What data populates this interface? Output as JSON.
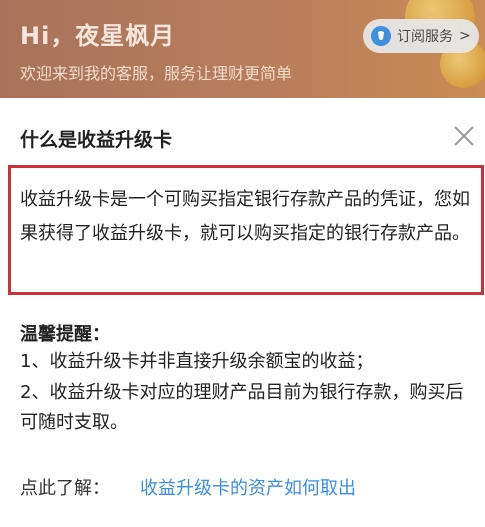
{
  "header": {
    "greeting": "Hi，夜星枫月",
    "welcome": "欢迎来到我的客服，服务让理财更简单",
    "subscribe_label": "订阅服务",
    "subscribe_arrow": ">"
  },
  "modal": {
    "title": "什么是收益升级卡",
    "definition": "收益升级卡是一个可购买指定银行存款产品的凭证，您如果获得了收益升级卡，就可以购买指定的银行存款产品。",
    "tips_title": "温馨提醒：",
    "tips": [
      "1、收益升级卡并非直接升级余额宝的收益；",
      "2、收益升级卡对应的理财产品目前为银行存款，购买后可随时支取。"
    ],
    "learn_label": "点此了解：",
    "learn_link": "收益升级卡的资产如何取出"
  },
  "colors": {
    "header_bg": "#b87d5c",
    "highlight_border": "#c9313b",
    "link": "#3a8ee6",
    "subscribe_icon": "#3f8ee0"
  },
  "icons": [
    "service-icon",
    "close-icon",
    "coin-decoration"
  ]
}
